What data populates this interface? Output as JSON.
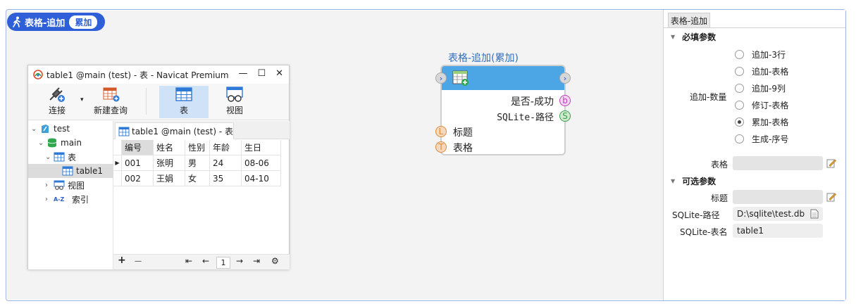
{
  "header": {
    "title": "表格-追加",
    "mode": "累加"
  },
  "navicat": {
    "window_title": "table1 @main (test) - 表 - Navicat Premium",
    "controls": {
      "minimize": "—",
      "maximize": "☐",
      "close": "✕"
    },
    "toolbar": {
      "connect": "连接",
      "new_query": "新建查询",
      "table": "表",
      "view": "视图"
    },
    "tree": [
      {
        "label": "test"
      },
      {
        "label": "main"
      },
      {
        "label": "表"
      },
      {
        "label": "table1"
      },
      {
        "label": "视图"
      },
      {
        "label": "索引"
      }
    ],
    "index_prefix": "A-Z",
    "tab_label": "table1 @main (test) - 表",
    "columns": [
      "编号",
      "姓名",
      "性别",
      "年龄",
      "生日"
    ],
    "rows": [
      [
        "001",
        "张明",
        "男",
        "24",
        "08-06"
      ],
      [
        "002",
        "王娟",
        "女",
        "35",
        "04-10"
      ]
    ],
    "footer": {
      "add": "+",
      "remove": "—",
      "first": "⇤",
      "prev": "←",
      "page": "1",
      "next": "→",
      "last": "⇥",
      "settings": "⚙"
    }
  },
  "node": {
    "title": "表格-追加(累加)",
    "outputs": [
      {
        "label": "是否-成功",
        "port": "b"
      },
      {
        "label": "SQLite-路径",
        "port": "S"
      }
    ],
    "inputs": [
      {
        "label": "标题",
        "port": "L"
      },
      {
        "label": "表格",
        "port": "T"
      }
    ]
  },
  "panel": {
    "tab": "表格-追加",
    "required_section": "必填参数",
    "count_label": "追加-数量",
    "options": [
      "追加-3行",
      "追加-表格",
      "追加-9列",
      "修订-表格",
      "累加-表格",
      "生成-序号"
    ],
    "selected": "累加-表格",
    "table_label": "表格",
    "optional_section": "可选参数",
    "title_label": "标题",
    "sqlite_path_label": "SQLite-路径",
    "sqlite_path_value": "D:\\sqlite\\test.db",
    "sqlite_table_label": "SQLite-表名",
    "sqlite_table_value": "table1"
  },
  "colors": {
    "accent": "#2e5fd8",
    "node_head": "#4ca6e6",
    "port_b": "#c040c0",
    "port_s": "#3aa050",
    "port_in": "#e08a3a"
  }
}
